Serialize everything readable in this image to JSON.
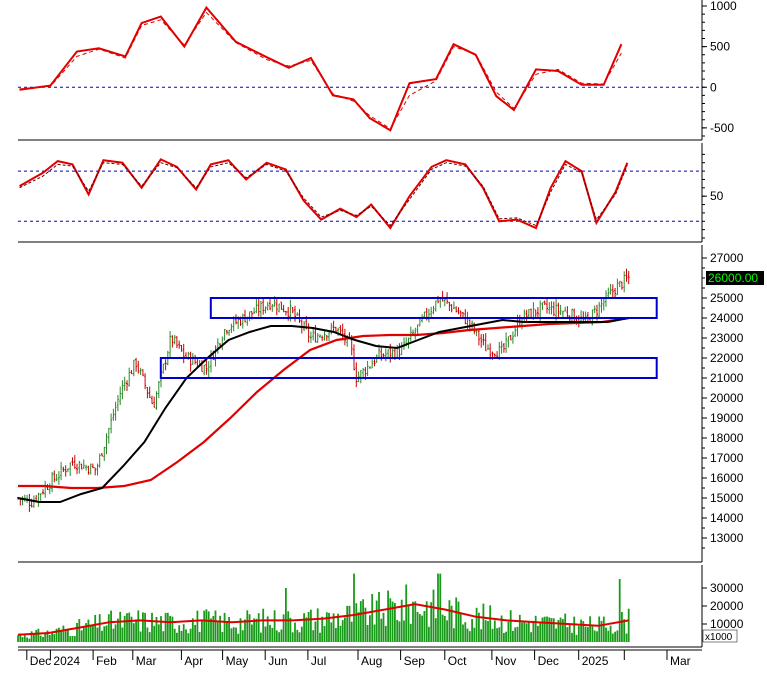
{
  "colors": {
    "price_up": "#2a8a2a",
    "price_down": "#cc0000",
    "ma_short": "#000000",
    "ma_long": "#e00000",
    "band": "#0000cc",
    "ref_line": "#0000cc",
    "osc": "#e00000",
    "volume": "#1a9a1a",
    "last_price_bg": "#000000",
    "last_price_fg": "#00ff00"
  },
  "chart_data": [
    {
      "type": "line",
      "panel": "oscillator-1",
      "x": [
        "2023-12-20",
        "2024-01-10",
        "2024-01-28",
        "2024-02-12",
        "2024-03-01",
        "2024-03-12",
        "2024-03-25",
        "2024-04-10",
        "2024-04-25",
        "2024-05-15",
        "2024-06-05",
        "2024-06-20",
        "2024-07-05",
        "2024-07-20",
        "2024-08-03",
        "2024-08-14",
        "2024-08-28",
        "2024-09-10",
        "2024-09-28",
        "2024-10-10",
        "2024-10-25",
        "2024-11-08",
        "2024-11-20",
        "2024-12-05",
        "2024-12-20",
        "2025-01-05",
        "2025-01-20",
        "2025-02-01"
      ],
      "series": [
        {
          "values": [
            -30,
            20,
            440,
            480,
            380,
            790,
            870,
            500,
            980,
            560,
            370,
            240,
            360,
            -100,
            -150,
            -380,
            -530,
            50,
            100,
            530,
            400,
            -110,
            -280,
            220,
            200,
            30,
            30,
            530
          ]
        },
        {
          "values": [
            -20,
            10,
            380,
            470,
            360,
            760,
            830,
            520,
            920,
            550,
            340,
            260,
            330,
            -80,
            -170,
            -350,
            -510,
            -100,
            80,
            500,
            410,
            -60,
            -260,
            160,
            220,
            50,
            40,
            420
          ]
        }
      ],
      "ylim": [
        -600,
        1000
      ],
      "ticks": [
        "1000",
        "500",
        "0",
        "-500"
      ],
      "ref_lines": [
        0
      ]
    },
    {
      "type": "line",
      "panel": "oscillator-2",
      "x": [
        "2023-12-20",
        "2024-01-05",
        "2024-01-15",
        "2024-01-25",
        "2024-02-05",
        "2024-02-15",
        "2024-02-28",
        "2024-03-12",
        "2024-03-25",
        "2024-04-05",
        "2024-04-18",
        "2024-04-28",
        "2024-05-10",
        "2024-05-22",
        "2024-06-05",
        "2024-06-18",
        "2024-06-30",
        "2024-07-12",
        "2024-07-25",
        "2024-08-05",
        "2024-08-15",
        "2024-08-28",
        "2024-09-10",
        "2024-09-25",
        "2024-10-05",
        "2024-10-18",
        "2024-10-30",
        "2024-11-10",
        "2024-11-22",
        "2024-12-05",
        "2024-12-15",
        "2024-12-25",
        "2025-01-05",
        "2025-01-15",
        "2025-01-28",
        "2025-02-05"
      ],
      "series": [
        {
          "values": [
            62,
            78,
            92,
            88,
            52,
            93,
            90,
            60,
            94,
            85,
            58,
            88,
            93,
            70,
            90,
            82,
            45,
            22,
            35,
            25,
            40,
            12,
            50,
            85,
            93,
            88,
            60,
            20,
            22,
            12,
            60,
            92,
            80,
            18,
            55,
            90
          ]
        },
        {
          "values": [
            60,
            74,
            88,
            86,
            56,
            90,
            88,
            62,
            90,
            84,
            60,
            85,
            90,
            72,
            88,
            80,
            48,
            25,
            33,
            27,
            38,
            15,
            46,
            82,
            90,
            86,
            62,
            23,
            24,
            15,
            55,
            88,
            78,
            22,
            52,
            87
          ]
        }
      ],
      "ylim": [
        0,
        110
      ],
      "ticks": [
        "50"
      ],
      "ref_lines": [
        80,
        20
      ]
    },
    {
      "type": "candlestick",
      "panel": "price",
      "x_start": "2023-12-19",
      "x_end": "2025-02-06",
      "anchors_x": [
        "2023-12-19",
        "2023-12-28",
        "2024-01-10",
        "2024-01-25",
        "2024-02-10",
        "2024-02-27",
        "2024-03-08",
        "2024-03-20",
        "2024-04-01",
        "2024-04-10",
        "2024-04-25",
        "2024-05-08",
        "2024-05-25",
        "2024-06-08",
        "2024-06-22",
        "2024-07-05",
        "2024-07-22",
        "2024-08-01",
        "2024-08-05",
        "2024-08-20",
        "2024-09-05",
        "2024-09-20",
        "2024-09-30",
        "2024-10-10",
        "2024-10-20",
        "2024-11-01",
        "2024-11-12",
        "2024-11-25",
        "2024-12-10",
        "2024-12-25",
        "2025-01-08",
        "2025-01-20",
        "2025-01-28",
        "2025-02-06"
      ],
      "anchors_close": [
        15000,
        14800,
        15800,
        16800,
        16400,
        20400,
        21800,
        19600,
        23000,
        22100,
        21500,
        23500,
        24200,
        24800,
        24300,
        23000,
        23500,
        22600,
        21000,
        22100,
        22400,
        24000,
        25000,
        24500,
        23800,
        22500,
        22300,
        24000,
        24500,
        24300,
        23800,
        24800,
        25500,
        26000
      ],
      "last_price_label": "26000.00",
      "ylim": [
        12000,
        27500
      ],
      "ticks": [
        "27000",
        "25000",
        "24000",
        "23000",
        "22000",
        "21000",
        "20000",
        "19000",
        "18000",
        "17000",
        "16000",
        "15000",
        "14000",
        "13000"
      ],
      "ma_short_anchors": [
        15000,
        14800,
        14800,
        15200,
        15500,
        16600,
        17800,
        19500,
        21000,
        22000,
        22900,
        23300,
        23600,
        23600,
        23500,
        23300,
        22900,
        22600,
        22500,
        22900,
        23300,
        23500,
        23700,
        23900,
        23800,
        23800,
        23800,
        23800,
        23800,
        24000
      ],
      "ma_long_anchors": [
        15600,
        15600,
        15500,
        15500,
        15600,
        15900,
        16800,
        17800,
        19000,
        20300,
        21400,
        22400,
        22900,
        23100,
        23150,
        23150,
        23250,
        23400,
        23500,
        23600,
        23700,
        23750,
        23800,
        24000
      ],
      "bands": [
        {
          "from": "2024-04-28",
          "to": "2025-02-25",
          "low": 24000,
          "high": 25000
        },
        {
          "from": "2024-03-25",
          "to": "2025-02-25",
          "low": 21000,
          "high": 22000
        }
      ]
    },
    {
      "type": "bar",
      "panel": "volume",
      "ylabel": "x1000",
      "ticks": [
        "30000",
        "20000",
        "10000"
      ],
      "ylim": [
        0,
        40000
      ],
      "spikes": [
        {
          "x": "2024-06-18",
          "value": 30000
        },
        {
          "x": "2024-08-03",
          "value": 38000
        },
        {
          "x": "2024-09-30",
          "value": 38000
        },
        {
          "x": "2025-01-31",
          "value": 35000
        }
      ],
      "ma_values": [
        4000,
        5000,
        8000,
        11000,
        12000,
        11000,
        12000,
        11000,
        12000,
        12000,
        13000,
        15000,
        18000,
        21000,
        18000,
        14000,
        12000,
        11000,
        10000,
        9000,
        12000
      ]
    }
  ],
  "x_axis": {
    "labels": [
      {
        "text": "Dec",
        "date": "2023-12-25"
      },
      {
        "text": "2024",
        "date": "2024-01-10"
      },
      {
        "text": "Feb",
        "date": "2024-02-08"
      },
      {
        "text": "Mar",
        "date": "2024-03-06"
      },
      {
        "text": "Apr",
        "date": "2024-04-08"
      },
      {
        "text": "May",
        "date": "2024-05-06"
      },
      {
        "text": "Jun",
        "date": "2024-06-04"
      },
      {
        "text": "Jul",
        "date": "2024-07-03"
      },
      {
        "text": "Aug",
        "date": "2024-08-06"
      },
      {
        "text": "Sep",
        "date": "2024-09-04"
      },
      {
        "text": "Oct",
        "date": "2024-10-04"
      },
      {
        "text": "Nov",
        "date": "2024-11-05"
      },
      {
        "text": "Dec",
        "date": "2024-12-04"
      },
      {
        "text": "2025",
        "date": "2025-01-03"
      },
      {
        "text": "",
        "date": "2025-02-03"
      },
      {
        "text": "Mar",
        "date": "2025-03-04"
      }
    ]
  }
}
